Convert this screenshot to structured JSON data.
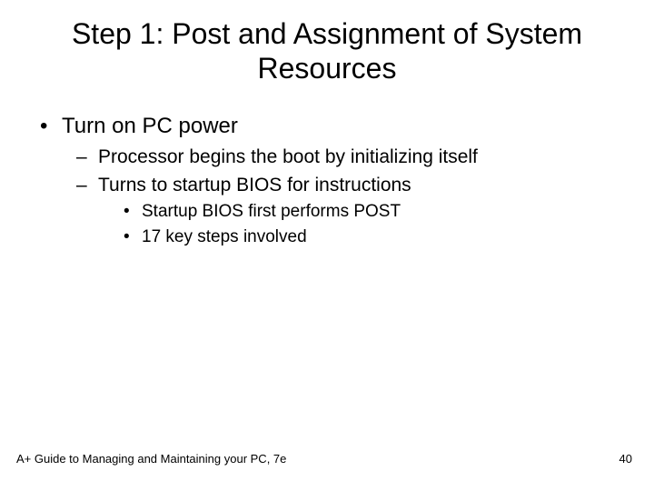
{
  "title": "Step 1: Post and Assignment of System Resources",
  "bullets": {
    "l1_0": "Turn on PC power",
    "l2_0": "Processor begins the boot by initializing itself",
    "l2_1": "Turns to startup BIOS for instructions",
    "l3_0": "Startup BIOS first performs POST",
    "l3_1": "17 key steps involved"
  },
  "footer": {
    "left": "A+ Guide to Managing and Maintaining your PC, 7e",
    "page": "40"
  }
}
